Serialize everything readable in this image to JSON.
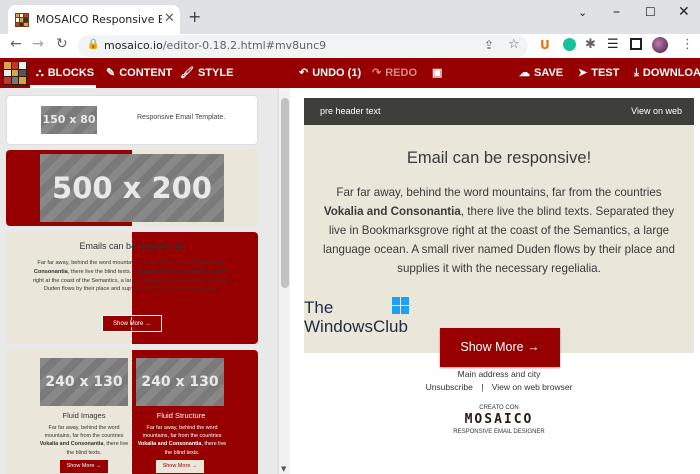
{
  "browser": {
    "tab_title": "MOSAICO Responsive Email Desi",
    "url_host": "mosaico.io",
    "url_path": "/editor-0.18.2.html#mv8unc9"
  },
  "app": {
    "tabs": {
      "blocks": "BLOCKS",
      "content": "CONTENT",
      "style": "STYLE"
    },
    "undo": "UNDO (1)",
    "redo": "REDO",
    "save": "SAVE",
    "test": "TEST",
    "download": "DOWNLOAD"
  },
  "blocks": {
    "b1": {
      "placeholder": "150 x 80",
      "text": "Responsive Email Template."
    },
    "b2": {
      "placeholder": "500 x 200"
    },
    "b3": {
      "title": "Emails can be responsive!",
      "body_pre": "Far far away, behind the word mountains, far from the countries ",
      "body_bold": "Vokalia and Consonantia",
      "body_post": ", there live the blind texts. Separated they live in Bookmarksgrove right at the coast of the Semantics, a large language ocean. A small river named Duden flows by their place and supplies it with the necessary regelialia.",
      "button": "Show More →"
    },
    "b4": {
      "left": {
        "placeholder": "240 x 130",
        "title": "Fluid Images",
        "body_pre": "Far far away, behind the word mountains, far from the countries ",
        "body_bold": "Vokalia and Consonantia",
        "body_post": ", there live the blind texts.",
        "button": "Show More →"
      },
      "right": {
        "placeholder": "240 x 130",
        "title": "Fluid Structure",
        "body_pre": "Far far away, behind the word mountains, far from the countries ",
        "body_bold": "Vokalia and Consonantia",
        "body_post": ", there live the blind texts.",
        "button": "Show More →"
      }
    }
  },
  "preview": {
    "preheader": "pre header text",
    "view_on_web": "View on web",
    "title": "Email can be responsive!",
    "body_pre": "Far far away, behind the word mountains, far from the countries ",
    "body_bold": "Vokalia and Consonantia",
    "body_post": ", there live the blind texts. Separated they live in Bookmarksgrove right at the coast of the Semantics, a large language ocean. A small river named Duden flows by their place and supplies it with the necessary regelialia.",
    "button": "Show More →",
    "footer_address": "Main address and city",
    "unsubscribe": "Unsubscribe",
    "separator": "|",
    "view_browser": "View on web browser",
    "creato_con": "CREATO CON",
    "mosaico_logo": "MOSAICO",
    "designer": "RESPONSIVE EMAIL DESIGNER"
  },
  "watermark": {
    "line1": "The",
    "line2": "WindowsClub"
  },
  "icons": [
    "mosaico-favicon",
    "close-icon",
    "plus-icon",
    "chevron-down-icon",
    "minimize-icon",
    "maximize-icon",
    "back-icon",
    "forward-icon",
    "reload-icon",
    "lock-icon",
    "share-icon",
    "star-icon",
    "extension-icon",
    "profile-avatar",
    "menu-icon",
    "blocks-icon",
    "content-icon",
    "style-icon",
    "undo-icon",
    "redo-icon",
    "image-icon",
    "save-icon",
    "test-icon",
    "download-icon"
  ],
  "colors": {
    "brand": "#960000",
    "preheader": "#3f3f3a",
    "email_bg": "#ebe6da"
  }
}
